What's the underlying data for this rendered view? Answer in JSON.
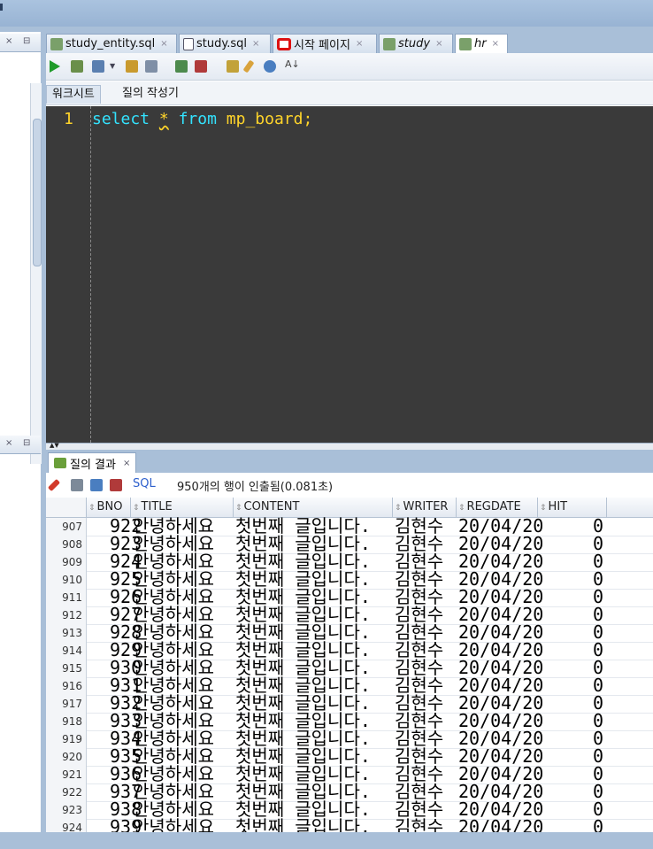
{
  "editor_tabs": [
    {
      "label": "study_entity.sql",
      "italic": false
    },
    {
      "label": "study.sql",
      "italic": false
    },
    {
      "label": "시작 페이지",
      "italic": false
    },
    {
      "label": "study",
      "italic": true
    },
    {
      "label": "hr",
      "italic": true
    }
  ],
  "subtabs": {
    "worksheet": "워크시트",
    "query_builder": "질의 작성기"
  },
  "editor": {
    "line_number": "1",
    "code": {
      "kw_select": "select",
      "star": "*",
      "kw_from": "from",
      "table": "mp_board;"
    }
  },
  "results": {
    "tab_label": "질의 결과",
    "sql_link": "SQL",
    "status": "950개의 행이 인출됨(0.081초)",
    "columns": [
      "BNO",
      "TITLE",
      "CONTENT",
      "WRITER",
      "REGDATE",
      "HIT"
    ],
    "rows": [
      {
        "n": "907",
        "bno": "922",
        "title": "안녕하세요",
        "content": "첫번째 글입니다.",
        "writer": "김현수",
        "regdate": "20/04/20",
        "hit": "0"
      },
      {
        "n": "908",
        "bno": "923",
        "title": "안녕하세요",
        "content": "첫번째 글입니다.",
        "writer": "김현수",
        "regdate": "20/04/20",
        "hit": "0"
      },
      {
        "n": "909",
        "bno": "924",
        "title": "안녕하세요",
        "content": "첫번째 글입니다.",
        "writer": "김현수",
        "regdate": "20/04/20",
        "hit": "0"
      },
      {
        "n": "910",
        "bno": "925",
        "title": "안녕하세요",
        "content": "첫번째 글입니다.",
        "writer": "김현수",
        "regdate": "20/04/20",
        "hit": "0"
      },
      {
        "n": "911",
        "bno": "926",
        "title": "안녕하세요",
        "content": "첫번째 글입니다.",
        "writer": "김현수",
        "regdate": "20/04/20",
        "hit": "0"
      },
      {
        "n": "912",
        "bno": "927",
        "title": "안녕하세요",
        "content": "첫번째 글입니다.",
        "writer": "김현수",
        "regdate": "20/04/20",
        "hit": "0"
      },
      {
        "n": "913",
        "bno": "928",
        "title": "안녕하세요",
        "content": "첫번째 글입니다.",
        "writer": "김현수",
        "regdate": "20/04/20",
        "hit": "0"
      },
      {
        "n": "914",
        "bno": "929",
        "title": "안녕하세요",
        "content": "첫번째 글입니다.",
        "writer": "김현수",
        "regdate": "20/04/20",
        "hit": "0"
      },
      {
        "n": "915",
        "bno": "930",
        "title": "안녕하세요",
        "content": "첫번째 글입니다.",
        "writer": "김현수",
        "regdate": "20/04/20",
        "hit": "0"
      },
      {
        "n": "916",
        "bno": "931",
        "title": "안녕하세요",
        "content": "첫번째 글입니다.",
        "writer": "김현수",
        "regdate": "20/04/20",
        "hit": "0"
      },
      {
        "n": "917",
        "bno": "932",
        "title": "안녕하세요",
        "content": "첫번째 글입니다.",
        "writer": "김현수",
        "regdate": "20/04/20",
        "hit": "0"
      },
      {
        "n": "918",
        "bno": "933",
        "title": "안녕하세요",
        "content": "첫번째 글입니다.",
        "writer": "김현수",
        "regdate": "20/04/20",
        "hit": "0"
      },
      {
        "n": "919",
        "bno": "934",
        "title": "안녕하세요",
        "content": "첫번째 글입니다.",
        "writer": "김현수",
        "regdate": "20/04/20",
        "hit": "0"
      },
      {
        "n": "920",
        "bno": "935",
        "title": "안녕하세요",
        "content": "첫번째 글입니다.",
        "writer": "김현수",
        "regdate": "20/04/20",
        "hit": "0"
      },
      {
        "n": "921",
        "bno": "936",
        "title": "안녕하세요",
        "content": "첫번째 글입니다.",
        "writer": "김현수",
        "regdate": "20/04/20",
        "hit": "0"
      },
      {
        "n": "922",
        "bno": "937",
        "title": "안녕하세요",
        "content": "첫번째 글입니다.",
        "writer": "김현수",
        "regdate": "20/04/20",
        "hit": "0"
      },
      {
        "n": "923",
        "bno": "938",
        "title": "안녕하세요",
        "content": "첫번째 글입니다.",
        "writer": "김현수",
        "regdate": "20/04/20",
        "hit": "0"
      },
      {
        "n": "924",
        "bno": "939",
        "title": "안녕하세요",
        "content": "첫번째 글입니다.",
        "writer": "김현수",
        "regdate": "20/04/20",
        "hit": "0"
      }
    ]
  },
  "colors": {
    "editor_bg": "#3a3a3a",
    "keyword": "#33e3ff",
    "identifier": "#ffd42a",
    "chrome": "#a9bfd8"
  }
}
